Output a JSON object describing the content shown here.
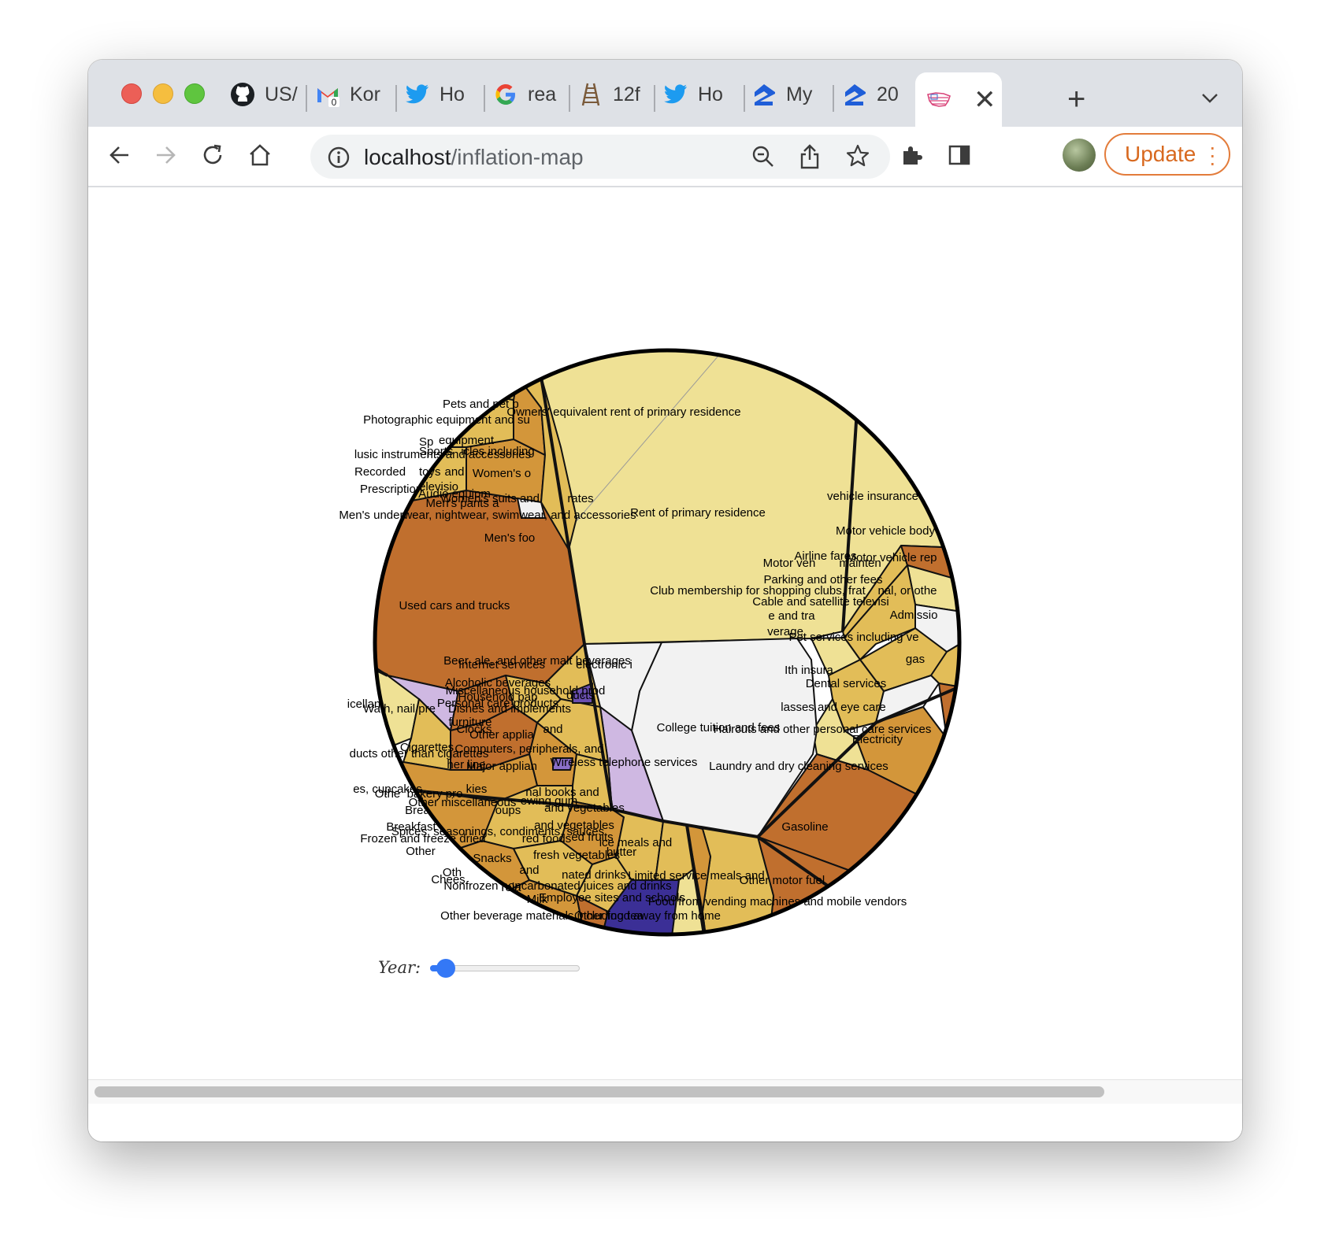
{
  "browser": {
    "tabs": [
      {
        "label": "US/",
        "icon": "github-icon"
      },
      {
        "label": "Kor",
        "icon": "gmail-icon",
        "badge": "0"
      },
      {
        "label": "Ho",
        "icon": "twitter-icon"
      },
      {
        "label": "rea",
        "icon": "google-icon"
      },
      {
        "label": "12f",
        "icon": "ladder-icon"
      },
      {
        "label": "Ho",
        "icon": "twitter-icon"
      },
      {
        "label": "My",
        "icon": "zillow-icon"
      },
      {
        "label": "20",
        "icon": "zillow-icon"
      }
    ],
    "active_tab": {
      "icon": "us-flag-icon",
      "close": "✕"
    },
    "new_tab": "+",
    "tab_menu": "⌄",
    "url_host": "localhost",
    "url_path": "/inflation-map",
    "update_label": "Update"
  },
  "viz": {
    "labels": [
      "Pets and pet p",
      "Owners' equivalent rent of primary residence",
      "Photographic equipment and su",
      "Sp",
      "equipment",
      "Sports",
      "icles including",
      "lusic instruments and accessories",
      "Recorded",
      "toys",
      "and",
      "Women's o",
      "Prescription",
      "elevisio",
      "Audio equipm",
      "Women's suits and",
      "rates",
      "Men's pants a",
      "Men's underwear, nightwear, swimwear, and accessories",
      "Rent of primary residence",
      "Men's foo",
      "vehicle insurance",
      "Motor vehicle body",
      "Airline fares",
      "Motor vehicle rep",
      "Motor veh",
      "mainten",
      "Parking and other fees",
      "Club membership for shopping clubs, frat",
      "nal, or othe",
      "Cable and satellite televisi",
      "Admissio",
      "e and tra",
      "Used cars and trucks",
      "verage",
      "Pet services including ve",
      "Beer, ale, and other malt beverages",
      "Internet services",
      "electronic i",
      "gas",
      "Alcoholic beverages",
      "Ith insura",
      "Miscellaneous household prod",
      "Dental services",
      "Household pap",
      "ducts",
      "icellan",
      "Personal care products",
      "lasses and eye care",
      "Wath, nail pre",
      "Dishes and implements",
      "Clocks",
      "furniture",
      "and",
      "College tuition and fees",
      "Haircuts and other personal care services",
      "Other applia",
      "Electricity",
      "Cigarettes",
      "Computers, peripherals, and",
      "ducts other than cigarettes",
      "her line",
      "Wireless telephone services",
      "Major applian",
      "Laundry and dry cleaning services",
      "es, cupcakes",
      "kies",
      "Othe",
      "bakery pro",
      "nal books and",
      "Other miscellaneous",
      "ewing gum",
      "Brea",
      "oups",
      "and vegetables",
      "Gasoline",
      "Breakfast",
      "Spices, seasonings, condiments, sauces",
      "and vegetables",
      "Frozen and freeze dried",
      "red foods",
      "ed fruits",
      "Other",
      "ice meals and",
      "fresh vegetables",
      "butter",
      "Snacks",
      "Oth",
      "and",
      "nated drinks",
      "Limited service meals and",
      "Other motor fuel",
      "Chees",
      "Nonfrozen noncarbonated juices and drinks",
      "rela",
      "Employee sites and schools",
      "Milk",
      "Food from vending machines and mobile vendors",
      "Other beverage materials including tea",
      "Other food away from home"
    ]
  }
}
